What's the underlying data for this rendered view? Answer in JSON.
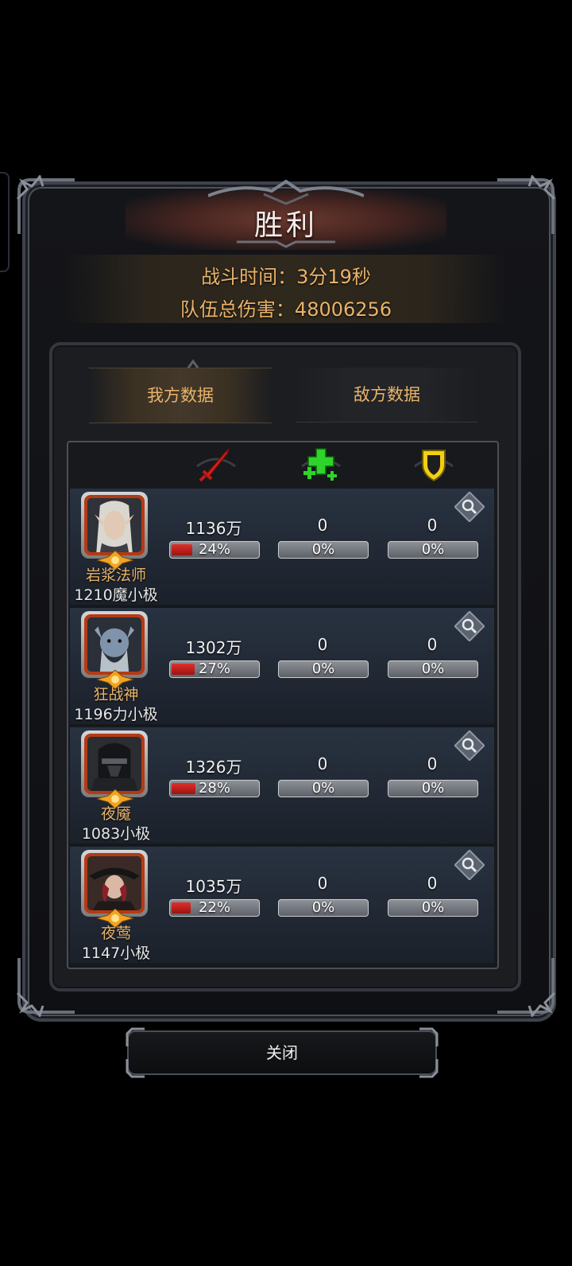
{
  "title": "胜利",
  "battle_time": "战斗时间：3分19秒",
  "team_damage": "队伍总伤害：48006256",
  "tabs": {
    "mine": "我方数据",
    "enemy": "敌方数据"
  },
  "column_icons": [
    "sword-icon",
    "heal-cross-icon",
    "shield-icon"
  ],
  "heroes": [
    {
      "name": "岩浆法师",
      "power": "1210魔小极",
      "damage": "1136万",
      "damage_pct": "24%",
      "damage_frac": 0.24,
      "heal": "0",
      "heal_pct": "0%",
      "tank": "0",
      "tank_pct": "0%"
    },
    {
      "name": "狂战神",
      "power": "1196力小极",
      "damage": "1302万",
      "damage_pct": "27%",
      "damage_frac": 0.27,
      "heal": "0",
      "heal_pct": "0%",
      "tank": "0",
      "tank_pct": "0%"
    },
    {
      "name": "夜魇",
      "power": "1083小极",
      "damage": "1326万",
      "damage_pct": "28%",
      "damage_frac": 0.28,
      "heal": "0",
      "heal_pct": "0%",
      "tank": "0",
      "tank_pct": "0%"
    },
    {
      "name": "夜莺",
      "power": "1147小极",
      "damage": "1035万",
      "damage_pct": "22%",
      "damage_frac": 0.22,
      "heal": "0",
      "heal_pct": "0%",
      "tank": "0",
      "tank_pct": "0%"
    }
  ],
  "close_label": "关闭",
  "colors": {
    "gold_text": "#e9b36a",
    "damage_red": "#c21a16",
    "frame": "#3e424b"
  }
}
